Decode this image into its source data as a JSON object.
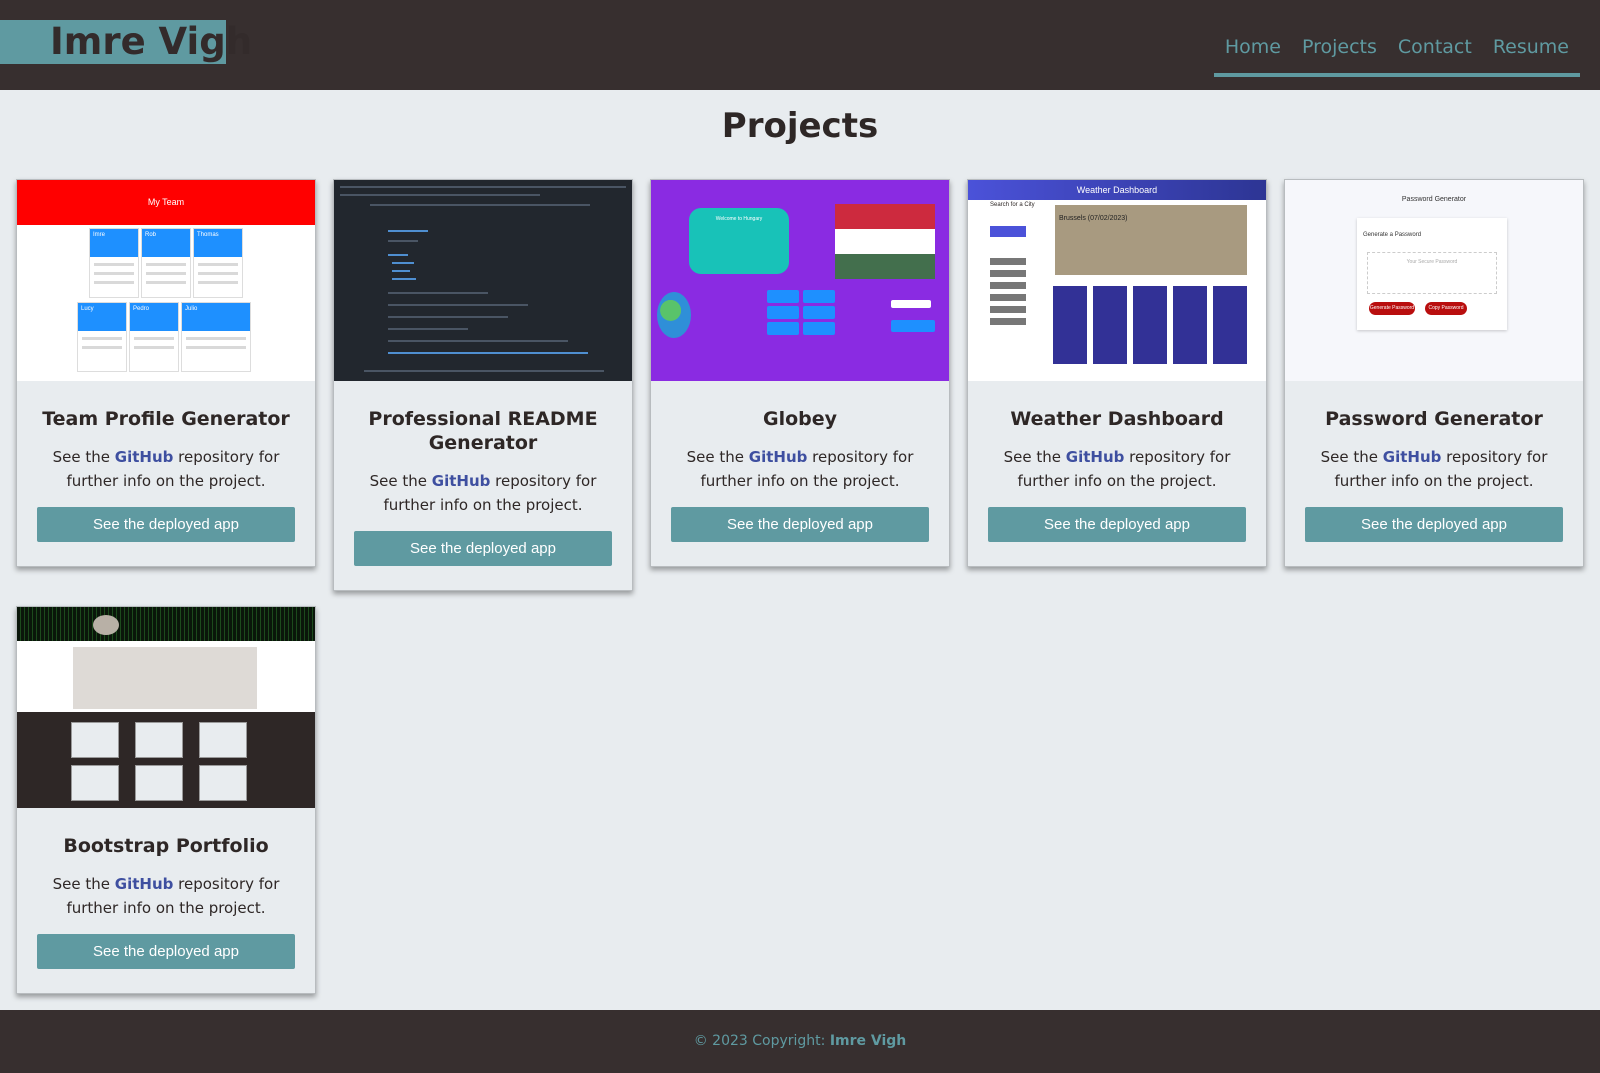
{
  "header": {
    "brand": "Imre Vigh",
    "nav": [
      "Home",
      "Projects",
      "Contact",
      "Resume"
    ]
  },
  "page_title": "Projects",
  "card_text": {
    "prefix": "See the",
    "link": "GitHub",
    "suffix": "repository for further info on the project.",
    "button": "See the deployed app"
  },
  "projects": [
    {
      "title": "Team Profile Generator",
      "thumb": {
        "heading": "My Team",
        "members": [
          {
            "name": "Imre",
            "role": "Manager"
          },
          {
            "name": "Rob",
            "role": "Engineer"
          },
          {
            "name": "Thomas",
            "role": "Engineer"
          },
          {
            "name": "Lucy",
            "role": "Engineer"
          },
          {
            "name": "Pedro",
            "role": "Engineer"
          },
          {
            "name": "Julio",
            "role": "Intern"
          }
        ]
      }
    },
    {
      "title": "Professional README Generator",
      "thumb": {}
    },
    {
      "title": "Globey",
      "thumb": {
        "bubble": "Welcome to Hungary"
      }
    },
    {
      "title": "Weather Dashboard",
      "thumb": {
        "heading": "Weather Dashboard",
        "search_label": "Search for a City",
        "city": "Brussels (07/02/2023)"
      }
    },
    {
      "title": "Password Generator",
      "thumb": {
        "heading": "Password Generator",
        "panel_heading": "Generate a Password",
        "placeholder": "Your Secure Password",
        "buttons": [
          "Generate Password",
          "Copy Password"
        ]
      }
    },
    {
      "title": "Bootstrap Portfolio",
      "thumb": {}
    }
  ],
  "footer": {
    "copyright": "© 2023 Copyright:",
    "name": "Imre Vigh"
  },
  "colors": {
    "header_bg": "#372f2f",
    "accent": "#5f9aa1",
    "page_bg": "#e8ecef",
    "link": "#3e4fa0"
  }
}
